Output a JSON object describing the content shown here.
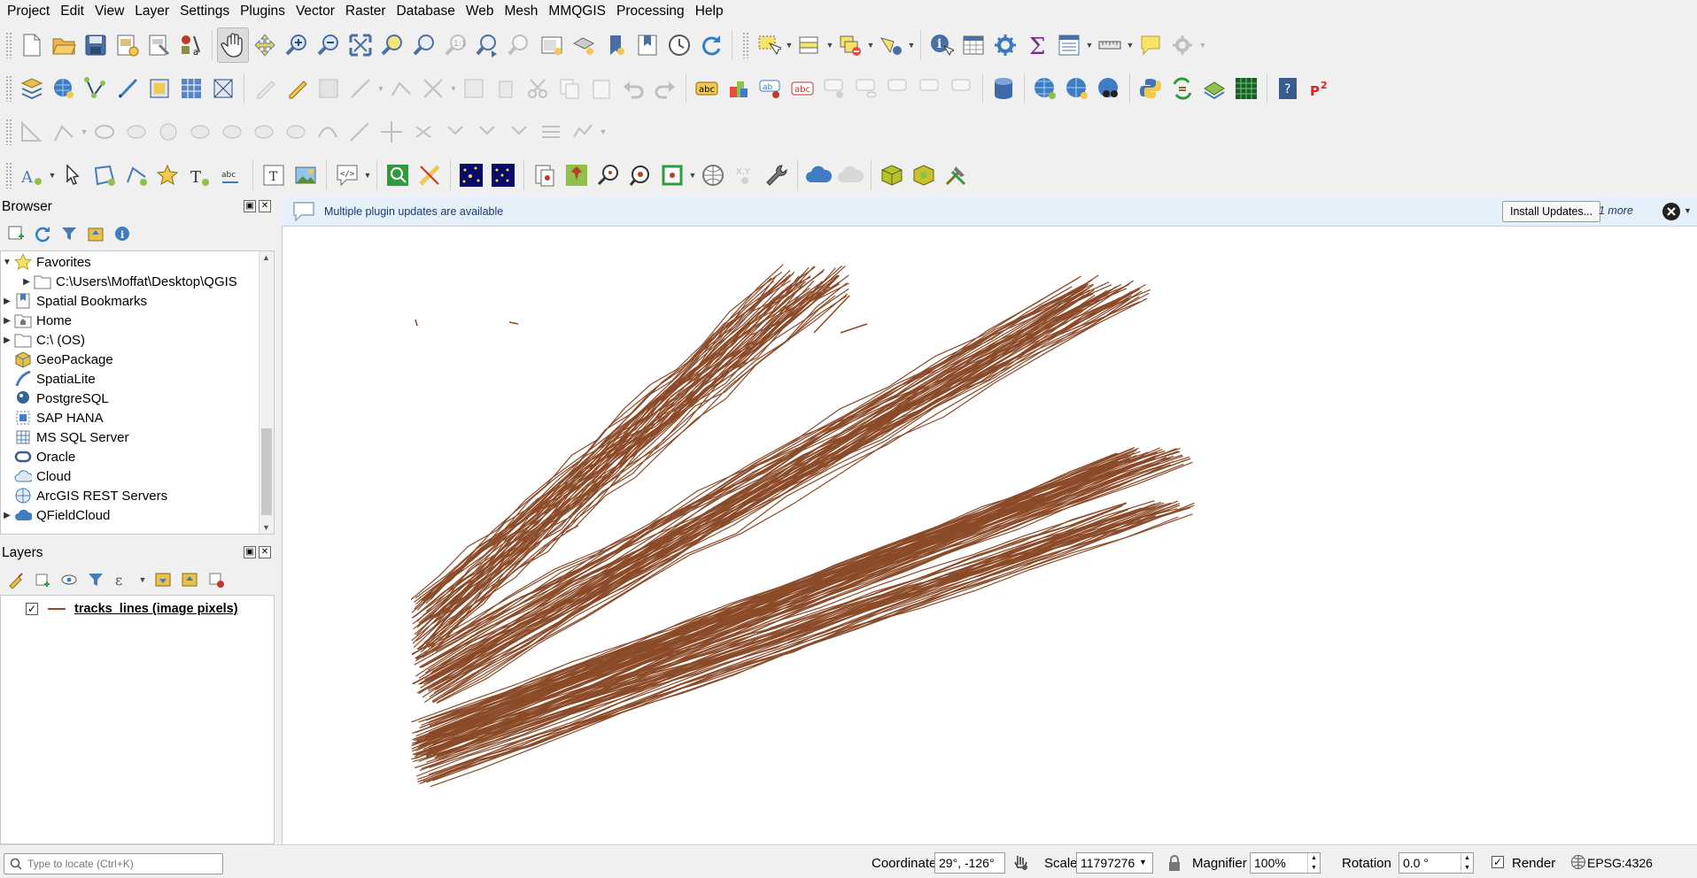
{
  "menubar": {
    "items": [
      "Project",
      "Edit",
      "View",
      "Layer",
      "Settings",
      "Plugins",
      "Vector",
      "Raster",
      "Database",
      "Web",
      "Mesh",
      "MMQGIS",
      "Processing",
      "Help"
    ]
  },
  "browser": {
    "title": "Browser",
    "items": [
      {
        "label": "Favorites",
        "icon": "star-icon",
        "expanded": true
      },
      {
        "label": "C:\\Users\\Moffat\\Desktop\\QGIS",
        "icon": "folder-icon"
      },
      {
        "label": "Spatial Bookmarks",
        "icon": "bookmark-icon"
      },
      {
        "label": "Home",
        "icon": "home-folder-icon"
      },
      {
        "label": "C:\\ (OS)",
        "icon": "folder-icon"
      },
      {
        "label": "GeoPackage",
        "icon": "geopackage-icon"
      },
      {
        "label": "SpatiaLite",
        "icon": "spatialite-icon"
      },
      {
        "label": "PostgreSQL",
        "icon": "postgresql-icon"
      },
      {
        "label": "SAP HANA",
        "icon": "sap-hana-icon"
      },
      {
        "label": "MS SQL Server",
        "icon": "mssql-icon"
      },
      {
        "label": "Oracle",
        "icon": "oracle-icon"
      },
      {
        "label": "Cloud",
        "icon": "cloud-icon"
      },
      {
        "label": "ArcGIS REST Servers",
        "icon": "arcgis-icon"
      },
      {
        "label": "QFieldCloud",
        "icon": "qfieldcloud-icon"
      }
    ]
  },
  "layers": {
    "title": "Layers",
    "items": [
      {
        "label": "tracks_lines (image pixels)",
        "checked": true,
        "color": "#8b4a28"
      }
    ]
  },
  "messagebar": {
    "text": "Multiple plugin updates are available",
    "button": "Install Updates...",
    "more": "1 more"
  },
  "map": {
    "line_color": "#8b4a28",
    "background": "#ffffff"
  },
  "statusbar": {
    "locator_placeholder": "Type to locate (Ctrl+K)",
    "coordinate_label": "Coordinate",
    "coordinate_value": "29°, -126°",
    "scale_label": "Scale",
    "scale_value": "11797276",
    "magnifier_label": "Magnifier",
    "magnifier_value": "100%",
    "rotation_label": "Rotation",
    "rotation_value": "0.0 °",
    "render_label": "Render",
    "render_checked": true,
    "crs": "EPSG:4326"
  }
}
